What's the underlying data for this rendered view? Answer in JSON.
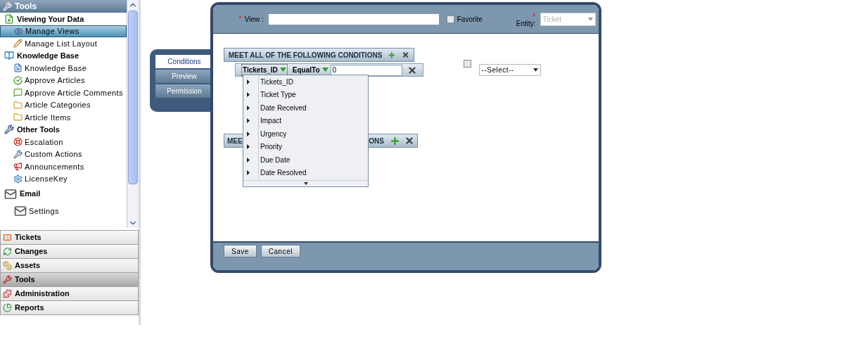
{
  "sidebar": {
    "title": "Tools",
    "groups": [
      {
        "label": "Viewing Your Data",
        "children": [
          {
            "label": "Manage Views",
            "selected": true
          },
          {
            "label": "Manage List Layout",
            "selected": false
          }
        ]
      },
      {
        "label": "Knowledge Base",
        "children": [
          {
            "label": "Knowledge Base",
            "selected": false
          },
          {
            "label": "Approve Articles",
            "selected": false
          },
          {
            "label": "Approve Article Comments",
            "selected": false
          },
          {
            "label": "Article Categories",
            "selected": false
          },
          {
            "label": "Article Items",
            "selected": false
          }
        ]
      },
      {
        "label": "Other Tools",
        "children": [
          {
            "label": "Escalation",
            "selected": false
          },
          {
            "label": "Custom Actions",
            "selected": false
          },
          {
            "label": "Announcements",
            "selected": false
          },
          {
            "label": "LicenseKey",
            "selected": false
          }
        ]
      },
      {
        "label": "Email",
        "children": [
          {
            "label": "Settings",
            "selected": false
          }
        ]
      }
    ],
    "modules": [
      {
        "label": "Tickets",
        "selected": false
      },
      {
        "label": "Changes",
        "selected": false
      },
      {
        "label": "Assets",
        "selected": false
      },
      {
        "label": "Tools",
        "selected": true
      },
      {
        "label": "Administration",
        "selected": false
      },
      {
        "label": "Reports",
        "selected": false
      }
    ]
  },
  "side_tabs": [
    {
      "label": "Conditions",
      "selected": true
    },
    {
      "label": "Preview",
      "selected": false
    },
    {
      "label": "Permission",
      "selected": false
    }
  ],
  "form": {
    "required_mark": "*",
    "view_label": "View :",
    "favorite_label": "Favorite",
    "favorite_checked": false,
    "entity_label": "Entity:",
    "entity_value": "Ticket"
  },
  "condition_group": {
    "title": "MEET ALL OF THE FOLLOWING CONDITIONS",
    "field": "Tickets_ID",
    "operator": "EqualTo",
    "value": "0",
    "extra_checked": false,
    "select_value": "--Select--"
  },
  "second_group": {
    "title_start": "MEE",
    "title_end": "ONS"
  },
  "field_menu": [
    "Tickets_ID",
    "Ticket Type",
    "Date Received",
    "Impact",
    "Urgency",
    "Priority",
    "Due Date",
    "Date Resolved"
  ],
  "buttons": [
    "Save",
    "Cancel"
  ]
}
